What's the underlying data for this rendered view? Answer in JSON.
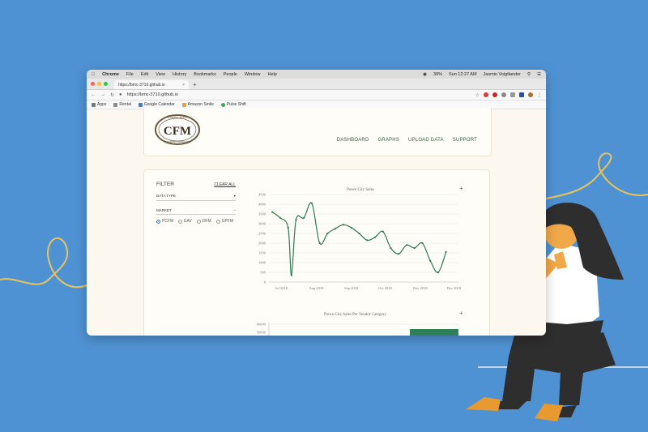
{
  "menubar": {
    "items": [
      "Chrome",
      "File",
      "Edit",
      "View",
      "History",
      "Bookmarks",
      "People",
      "Window",
      "Help"
    ],
    "battery": "39%",
    "clock": "Sun 12:27 AM",
    "user": "Jasmin Voigtlander"
  },
  "tab": {
    "title": "https://bmc-3710.github.io",
    "close": "×"
  },
  "address": {
    "url": "https://bmc-3710.github.io"
  },
  "bookmarks": [
    {
      "label": "Apps",
      "color": "#777777"
    },
    {
      "label": "Rental",
      "color": "#8a8a8a"
    },
    {
      "label": "Google Calendar",
      "color": "#3b7be0"
    },
    {
      "label": "Amazon Smile",
      "color": "#f0a030"
    },
    {
      "label": "Pulse Shift",
      "color": "#3da85a"
    }
  ],
  "logo": {
    "text": "CFM",
    "top": "COMMUNITY",
    "bottom": "FARMERS MARKETS"
  },
  "nav": {
    "dashboard": "DASHBOARD",
    "graphs": "GRAPHS",
    "upload": "UPLOAD DATA",
    "support": "SUPPORT"
  },
  "filter": {
    "title": "FILTER",
    "clear_all": "CLEAR ALL",
    "data_type": "DATA TYPE",
    "market": "MARKET",
    "radios": [
      {
        "label": "PCFM",
        "checked": true
      },
      {
        "label": "EAV",
        "checked": false
      },
      {
        "label": "DFM",
        "checked": false
      },
      {
        "label": "GPFM",
        "checked": false
      }
    ]
  },
  "chart_data": [
    {
      "type": "line",
      "title": "Ponce City Sales",
      "x_tick_labels": [
        "Jul 2018",
        "Aug 2018",
        "Sep 2018",
        "Oct 2018",
        "Nov 2018",
        "Dec 2018"
      ],
      "ylim": [
        0,
        4500
      ],
      "y_ticks": [
        0,
        500,
        1000,
        1500,
        2000,
        2500,
        3000,
        3500,
        4000,
        4500
      ],
      "series": [
        {
          "color": "#2d7a4e",
          "points": [
            {
              "x": "2018-06-23",
              "y": 3600
            },
            {
              "x": "2018-06-30",
              "y": 3300
            },
            {
              "x": "2018-07-07",
              "y": 2800
            },
            {
              "x": "2018-07-10",
              "y": 350
            },
            {
              "x": "2018-07-14",
              "y": 3200
            },
            {
              "x": "2018-07-21",
              "y": 3300
            },
            {
              "x": "2018-07-28",
              "y": 4050
            },
            {
              "x": "2018-08-04",
              "y": 2000
            },
            {
              "x": "2018-08-11",
              "y": 2500
            },
            {
              "x": "2018-08-18",
              "y": 2750
            },
            {
              "x": "2018-08-25",
              "y": 2950
            },
            {
              "x": "2018-09-01",
              "y": 2800
            },
            {
              "x": "2018-09-08",
              "y": 2500
            },
            {
              "x": "2018-09-15",
              "y": 2150
            },
            {
              "x": "2018-09-22",
              "y": 2300
            },
            {
              "x": "2018-09-29",
              "y": 2600
            },
            {
              "x": "2018-10-06",
              "y": 1750
            },
            {
              "x": "2018-10-13",
              "y": 1450
            },
            {
              "x": "2018-10-20",
              "y": 1900
            },
            {
              "x": "2018-10-27",
              "y": 1750
            },
            {
              "x": "2018-11-03",
              "y": 2000
            },
            {
              "x": "2018-11-10",
              "y": 1100
            },
            {
              "x": "2018-11-17",
              "y": 500
            },
            {
              "x": "2018-11-24",
              "y": 1550
            }
          ]
        }
      ]
    },
    {
      "type": "bar",
      "title": "Ponce City Sales Per Vendor Category",
      "y_tick_labels_visible": [
        "60000",
        "50000"
      ],
      "bar_color": "#2f7f57"
    }
  ]
}
